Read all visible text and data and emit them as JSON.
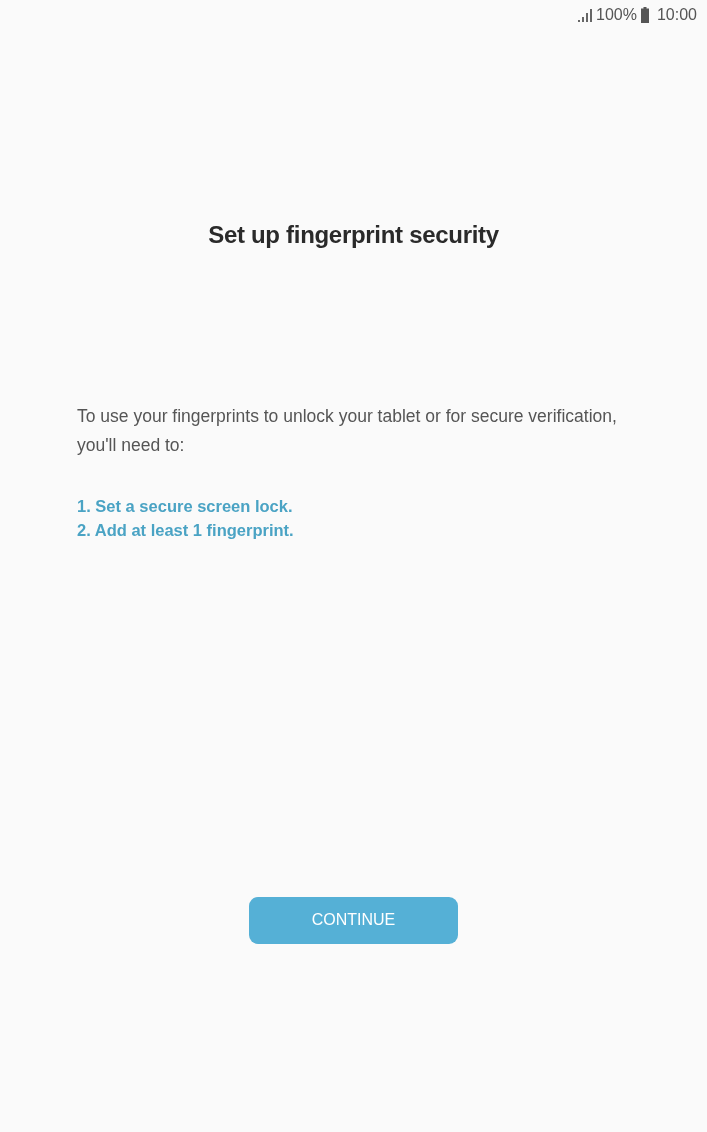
{
  "status_bar": {
    "battery": "100%",
    "time": "10:00"
  },
  "title": "Set up fingerprint security",
  "description": "To use your fingerprints to unlock your tablet or for secure verification, you'll need to:",
  "steps": [
    "1. Set a secure screen lock.",
    "2. Add at least 1 fingerprint."
  ],
  "continue_button": {
    "label": "CONTINUE"
  }
}
